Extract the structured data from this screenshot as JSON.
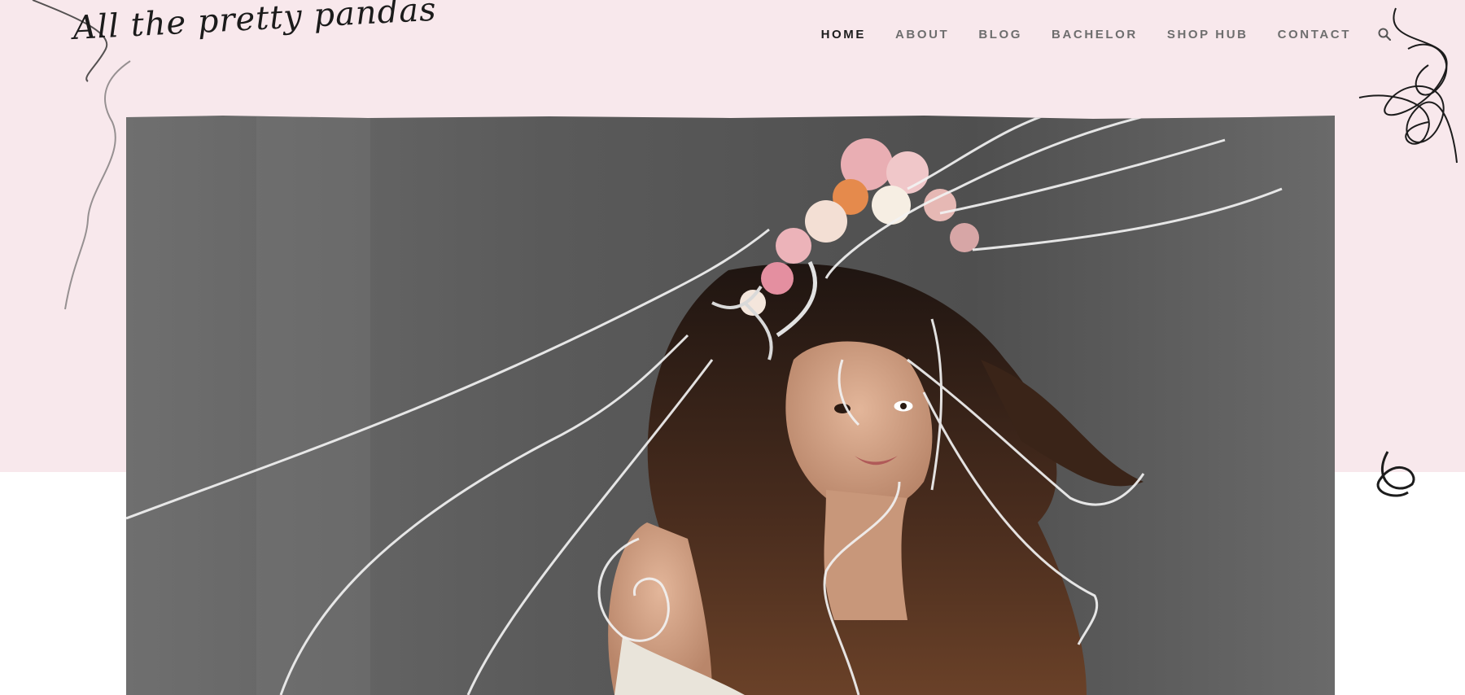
{
  "site": {
    "logo_text": "All the pretty pandas"
  },
  "nav": {
    "items": [
      {
        "label": "HOME",
        "active": true
      },
      {
        "label": "ABOUT",
        "active": false
      },
      {
        "label": "BLOG",
        "active": false
      },
      {
        "label": "BACHELOR",
        "active": false
      },
      {
        "label": "SHOP HUB",
        "active": false
      },
      {
        "label": "CONTACT",
        "active": false
      }
    ],
    "search_icon": "search-icon"
  },
  "hero": {
    "image": "portrait-of-woman-with-flower-crown-and-line-art"
  },
  "colors": {
    "pink_band": "#f8e8ec",
    "nav_active": "#1c1c1c",
    "nav_inactive": "#6e6e6e",
    "hero_bg": "#5b5b5b"
  }
}
